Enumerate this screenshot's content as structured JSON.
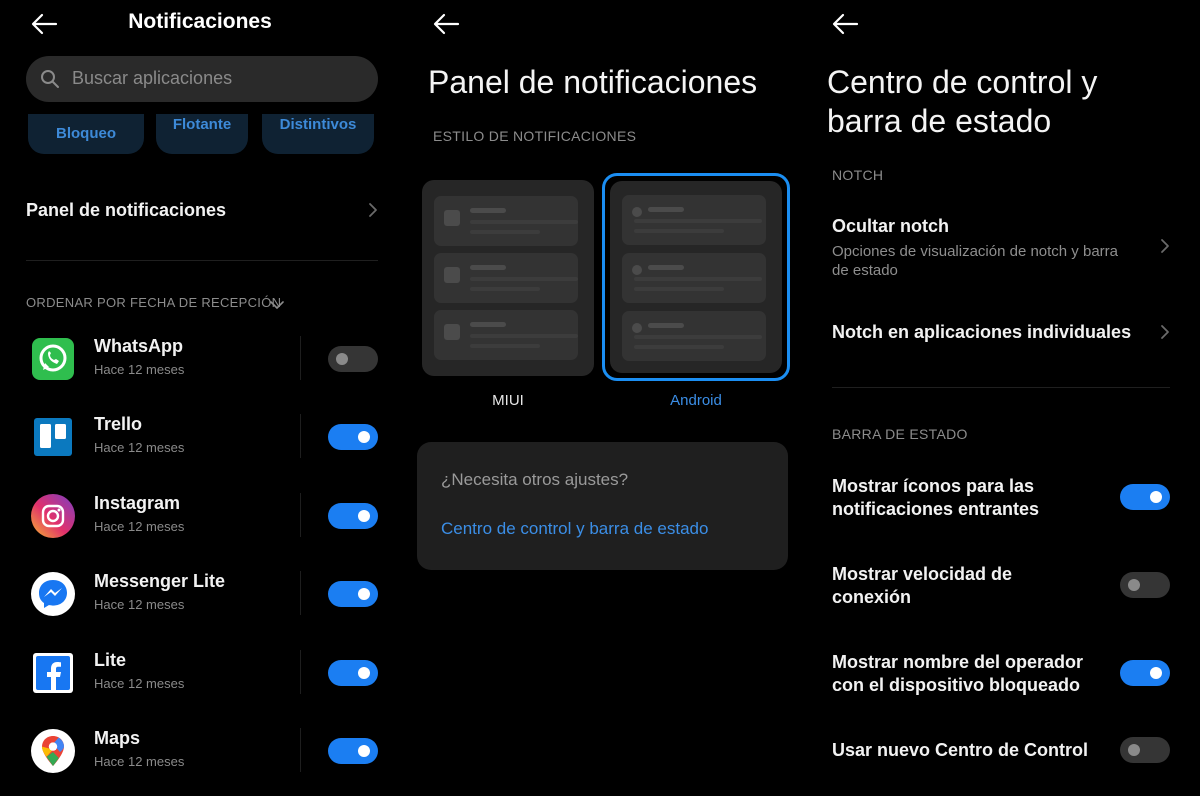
{
  "panel1": {
    "title": "Notificaciones",
    "search_placeholder": "Buscar aplicaciones",
    "chips": [
      "Bloqueo",
      "Flotante",
      "Distintivos"
    ],
    "row_label": "Panel de notificaciones",
    "sort_label": "ORDENAR POR FECHA DE RECEPCIÓN",
    "apps": [
      {
        "name": "WhatsApp",
        "sub": "Hace 12 meses",
        "enabled": false,
        "icon": "whatsapp-icon"
      },
      {
        "name": "Trello",
        "sub": "Hace 12 meses",
        "enabled": true,
        "icon": "trello-icon"
      },
      {
        "name": "Instagram",
        "sub": "Hace 12 meses",
        "enabled": true,
        "icon": "instagram-icon"
      },
      {
        "name": "Messenger Lite",
        "sub": "Hace 12 meses",
        "enabled": true,
        "icon": "messenger-icon"
      },
      {
        "name": "Lite",
        "sub": "Hace 12 meses",
        "enabled": true,
        "icon": "facebook-icon"
      },
      {
        "name": "Maps",
        "sub": "Hace 12 meses",
        "enabled": true,
        "icon": "maps-icon"
      }
    ]
  },
  "panel2": {
    "title": "Panel de notificaciones",
    "section": "ESTILO DE NOTIFICACIONES",
    "options": [
      {
        "label": "MIUI",
        "selected": false
      },
      {
        "label": "Android",
        "selected": true
      }
    ],
    "question": "¿Necesita otros ajustes?",
    "link": "Centro de control y barra de estado"
  },
  "panel3": {
    "title_line1": "Centro de control y",
    "title_line2": "barra de estado",
    "notch_section": "NOTCH",
    "hide_notch_title": "Ocultar notch",
    "hide_notch_sub_line1": "Opciones de visualización de notch y barra",
    "hide_notch_sub_line2": "de estado",
    "notch_apps_title": "Notch en aplicaciones individuales",
    "status_section": "BARRA DE ESTADO",
    "settings": [
      {
        "line1": "Mostrar íconos para las",
        "line2": "notificaciones entrantes",
        "enabled": true
      },
      {
        "line1": "Mostrar velocidad de",
        "line2": "conexión",
        "enabled": false
      },
      {
        "line1": "Mostrar nombre del operador",
        "line2": "con el dispositivo bloqueado",
        "enabled": true
      },
      {
        "line1": "Usar nuevo Centro de Control",
        "line2": "",
        "enabled": false
      }
    ]
  },
  "colors": {
    "accent": "#1b7ef2",
    "link": "#3b8ee6",
    "toggle_off": "#353535",
    "background": "#000000"
  }
}
